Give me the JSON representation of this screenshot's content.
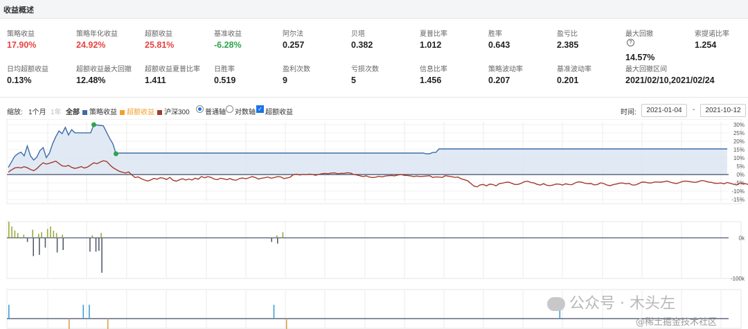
{
  "section_title": "收益概述",
  "metrics_row1": [
    {
      "label": "策略收益",
      "value": "17.90%",
      "tone": "red"
    },
    {
      "label": "策略年化收益",
      "value": "24.92%",
      "tone": "red"
    },
    {
      "label": "超额收益",
      "value": "25.81%",
      "tone": "red"
    },
    {
      "label": "基准收益",
      "value": "-6.28%",
      "tone": "green"
    },
    {
      "label": "阿尔法",
      "value": "0.257",
      "tone": "normal"
    },
    {
      "label": "贝塔",
      "value": "0.382",
      "tone": "normal"
    },
    {
      "label": "夏普比率",
      "value": "1.012",
      "tone": "normal"
    },
    {
      "label": "胜率",
      "value": "0.643",
      "tone": "normal"
    },
    {
      "label": "盈亏比",
      "value": "2.385",
      "tone": "normal"
    },
    {
      "label": "最大回撤",
      "value": "14.57%",
      "tone": "normal",
      "help_icon": "question-circle-icon"
    },
    {
      "label": "索提诺比率",
      "value": "1.254",
      "tone": "normal"
    }
  ],
  "metrics_row2": [
    {
      "label": "日均超额收益",
      "value": "0.13%"
    },
    {
      "label": "超额收益最大回撤",
      "value": "12.48%"
    },
    {
      "label": "超额收益夏普比率",
      "value": "1.411"
    },
    {
      "label": "日胜率",
      "value": "0.519"
    },
    {
      "label": "盈利次数",
      "value": "9"
    },
    {
      "label": "亏损次数",
      "value": "5"
    },
    {
      "label": "信息比率",
      "value": "1.456"
    },
    {
      "label": "策略波动率",
      "value": "0.207"
    },
    {
      "label": "基准波动率",
      "value": "0.201"
    },
    {
      "label": "最大回撤区间",
      "value": "2021/02/10,2021/02/24"
    }
  ],
  "toolbar": {
    "zoom_label": "缩放:",
    "zoom_1m": "1个月",
    "zoom_1y": "1年",
    "zoom_all": "全部",
    "legend_strategy": "策略收益",
    "legend_excess": "超额收益",
    "legend_benchmark": "沪深300",
    "axis_normal": "普通轴",
    "axis_log": "对数轴",
    "excess_checkbox": "超额收益",
    "time_label": "时间:",
    "date_from": "2021-01-04",
    "date_to": "2021-10-12",
    "date_sep": "-"
  },
  "colors": {
    "strategy": "#3d6baa",
    "excess": "#f0a030",
    "benchmark": "#a33a2c",
    "red": "#e64340",
    "green": "#2da44e",
    "accent": "#1a73e8"
  },
  "chart_data": [
    {
      "type": "line",
      "series": [
        {
          "name": "策略收益",
          "values": [
            4.3,
            7.6,
            10.9,
            12.5,
            13.5,
            11.2,
            17.2,
            11.2,
            8.7,
            10.5,
            14.4,
            16.2,
            10.2,
            12.9,
            18.6,
            22.8,
            26.2,
            24.6,
            28.4,
            23.8,
            27,
            25.1,
            25.1,
            25.1,
            25.1,
            25.1,
            25.1,
            30,
            29.8,
            29.6,
            29.3,
            25.5,
            21.8,
            18.6,
            12.5,
            12.9,
            12.9,
            12.9,
            12.9,
            12.9,
            12.9,
            12.9,
            12.9,
            12.9,
            12.9,
            12.9,
            12.9,
            12.9,
            12.9,
            12.9,
            12.9,
            12.9,
            12.9,
            12.9,
            12.9,
            12.9,
            12.9,
            12.9,
            12.9,
            12.9,
            12.9,
            12.9,
            12.9,
            12.9,
            12.9,
            12.9,
            12.9,
            12.9,
            12.9,
            12.9,
            12.9,
            12.9,
            12.9,
            12.9,
            12.9,
            12.9,
            12.9,
            12.9,
            12.9,
            12.9,
            12.9,
            12.9,
            12.9,
            12.9,
            12.9,
            12.9,
            12.9,
            12.9,
            12.9,
            12.9,
            12.9,
            12.9,
            12.9,
            12.9,
            12.9,
            12.9,
            12.9,
            12.9,
            12.9,
            12.9,
            12.9,
            12.9,
            12.9,
            12.9,
            12.9,
            12.9,
            12.9,
            12.9,
            12.9,
            12.9,
            12.9,
            12.9,
            12.9,
            12.9,
            12.9,
            12.9,
            12.9,
            12.9,
            12.9,
            12.9,
            12.9,
            12.9,
            12.9,
            12.9,
            12.9,
            12.9,
            12.9,
            12.9,
            12.9,
            12.9,
            12.9,
            12.9,
            12.5,
            12.5,
            13.3,
            13.3,
            15.4,
            15.4,
            15.4,
            15.4,
            15.4,
            15.4,
            15.4,
            15.4,
            15.4,
            15.4,
            15.4,
            15.4,
            15.4,
            15.4,
            15.4,
            15.4,
            15.4,
            15.4,
            15.4,
            15.4,
            15.4,
            15.4,
            15.4,
            15.4,
            15.4,
            15.4,
            15.4,
            15.4,
            15.4,
            15.4,
            15.4,
            15.4,
            15.4,
            15.4,
            15.4,
            15.4,
            15.4,
            15.4,
            15.4,
            15.4,
            15.4,
            15.4,
            15.4,
            15.4,
            15.4,
            15.4,
            15.4,
            15.4,
            15.4,
            15.4,
            15.4,
            15.4,
            15.4,
            15.4,
            15.4,
            15.4,
            15.4,
            15.4,
            15.4,
            15.4,
            15.4,
            15.4,
            15.4,
            15.4,
            15.4,
            15.4,
            15.4,
            15.4,
            15.4,
            15.4,
            15.4,
            15.4,
            15.4,
            15.4,
            15.4,
            15.4,
            15.4,
            15.4,
            15.4,
            15.4,
            15.4,
            15.4,
            15.4,
            15.4,
            15.4,
            15.4,
            15.4,
            15.4,
            15.4,
            15.4,
            15.4,
            15.4
          ]
        },
        {
          "name": "沪深300",
          "values": [
            1.4,
            2.8,
            3.9,
            4.3,
            4,
            4.7,
            4.1,
            3.1,
            2.3,
            3.6,
            5.4,
            7.1,
            6.3,
            6.8,
            7.4,
            8.1,
            6.6,
            5.2,
            4.9,
            5.5,
            4.3,
            3.7,
            4.1,
            4.8,
            3.9,
            4.5,
            5.8,
            7.1,
            6.5,
            7.5,
            8.3,
            7.9,
            6,
            4.2,
            3.1,
            2,
            1.4,
            0.9,
            1.6,
            -0.2,
            -1.8,
            -1.4,
            -2.5,
            -3.3,
            -3.9,
            -3.2,
            -2.3,
            -2.8,
            -1.9,
            -2.2,
            -3,
            -1.7,
            -3.4,
            -4,
            -3.2,
            -2.5,
            -3.3,
            -2.7,
            -3.3,
            -2.2,
            -2.8,
            -1.2,
            -1.9,
            -1.3,
            -1.7,
            -2.7,
            -3.1,
            -2.2,
            -2.6,
            -3.1,
            -2.4,
            -3.2,
            -3.4,
            -2.4,
            -2.1,
            -2.6,
            -1.9,
            -1.2,
            -1.8,
            -2.7,
            -2.2,
            -1.9,
            -1.5,
            -2.2,
            -1.8,
            -1.2,
            -1.4,
            -2.4,
            -2.1,
            -1.6,
            -0.1,
            0.2,
            -0.3,
            0.1,
            -0.1,
            0.2,
            0.1,
            -0.5,
            0.1,
            0.5,
            0.7,
            0.5,
            0.9,
            1,
            0.5,
            0.7,
            0.7,
            1.1,
            0.9,
            0.1,
            -0.3,
            -0.7,
            -1.2,
            -0.8,
            -1.5,
            -1.8,
            -1.6,
            -1.1,
            -1.4,
            -0.9,
            -0.7,
            -0.6,
            -0.8,
            -0.3,
            0,
            -0.5,
            -0.6,
            -0.8,
            -1.2,
            -0.9,
            -1.2,
            -1.1,
            -0.9,
            -0.7,
            -1.7,
            -1.4,
            -1.5,
            -1.7,
            -0.7,
            -1,
            -1.3,
            -1.7,
            -1.5,
            -2.6,
            -3.1,
            -3.7,
            -5.3,
            -6.9,
            -7.4,
            -6.2,
            -6,
            -6.8,
            -5.8,
            -6,
            -6.8,
            -5.5,
            -5.2,
            -4.7,
            -4.6,
            -5.3,
            -6,
            -5.9,
            -5.2,
            -4.3,
            -4,
            -4.8,
            -5.1,
            -5.9,
            -6.3,
            -5.5,
            -6.4,
            -6.7,
            -6.3,
            -5.7,
            -5.8,
            -6.3,
            -5.6,
            -6,
            -6.1,
            -5,
            -4.4,
            -4.6,
            -5.2,
            -5.5,
            -5.4,
            -6.2,
            -6,
            -5,
            -5.4,
            -6.3,
            -6.7,
            -6.1,
            -5.7,
            -5.2,
            -5.1,
            -5.6,
            -5.3,
            -6.3,
            -6.3,
            -5.5,
            -4.6,
            -4.6,
            -5,
            -5.1,
            -4.5,
            -4.5,
            -4.6,
            -4.3,
            -3.9,
            -4.6,
            -5.1,
            -5.4,
            -4.8,
            -4.1,
            -3.9,
            -4.2,
            -4.5,
            -4.7,
            -4.2,
            -3.6,
            -3.9,
            -4.5,
            -4.7,
            -5.2,
            -5.3,
            -5.1,
            -5.6,
            -4.8,
            -5.3,
            -5.8,
            -6.3,
            -5.1,
            -5.4,
            -5.6,
            -6.3,
            -6.7,
            -6.3,
            -5.8,
            -5.6,
            -4.8,
            -4.5,
            -5.1,
            -5.8,
            -6.3,
            -6.2,
            -5.9,
            -5.4,
            -4.3,
            -4.7,
            -5.2,
            -5.4,
            -5.3,
            -5.6,
            -5.9,
            -5.3,
            -4.6,
            -4.5,
            -5.2,
            -5.8,
            -6.3
          ]
        }
      ],
      "ylim": [
        -15,
        30
      ],
      "y_ticks": [
        "30%",
        "25%",
        "20%",
        "15%",
        "10%",
        "5%",
        "0%",
        "-5%",
        "-10%",
        "-15%"
      ],
      "markers": [
        {
          "x_index": 27,
          "y": 30,
          "color": "#2da44e"
        },
        {
          "x_index": 34,
          "y": 12.5,
          "color": "#2da44e"
        }
      ],
      "grid": true,
      "legend": "top-left"
    },
    {
      "type": "bar",
      "y_ticks": [
        "0k",
        "-100k"
      ],
      "ylim": [
        -100,
        40
      ],
      "positive": [
        [
          0,
          40
        ],
        [
          1,
          28
        ],
        [
          2,
          18
        ],
        [
          3,
          12
        ],
        [
          5,
          8
        ],
        [
          8,
          20
        ],
        [
          10,
          10
        ],
        [
          11,
          14
        ],
        [
          13,
          22
        ],
        [
          14,
          28
        ],
        [
          15,
          18
        ],
        [
          16,
          12
        ],
        [
          18,
          8
        ],
        [
          28,
          6
        ],
        [
          31,
          12
        ],
        [
          90,
          6
        ],
        [
          92,
          14
        ]
      ],
      "negative": [
        [
          6,
          -10
        ],
        [
          8,
          -45
        ],
        [
          10,
          -42
        ],
        [
          12,
          -24
        ],
        [
          16,
          -36
        ],
        [
          18,
          -30
        ],
        [
          27,
          -34
        ],
        [
          29,
          -34
        ],
        [
          30,
          -32
        ],
        [
          31,
          -86
        ],
        [
          88,
          -10
        ],
        [
          90,
          -14
        ]
      ]
    },
    {
      "type": "bar",
      "blue": [
        0,
        25,
        27,
        89,
        185
      ],
      "orange": [
        [
          20,
          -18
        ],
        [
          33,
          -18
        ],
        [
          93,
          -18
        ]
      ]
    }
  ],
  "watermark": {
    "line1": "公众号 · 木头左",
    "line2": "@稀土掘金技术社区"
  }
}
